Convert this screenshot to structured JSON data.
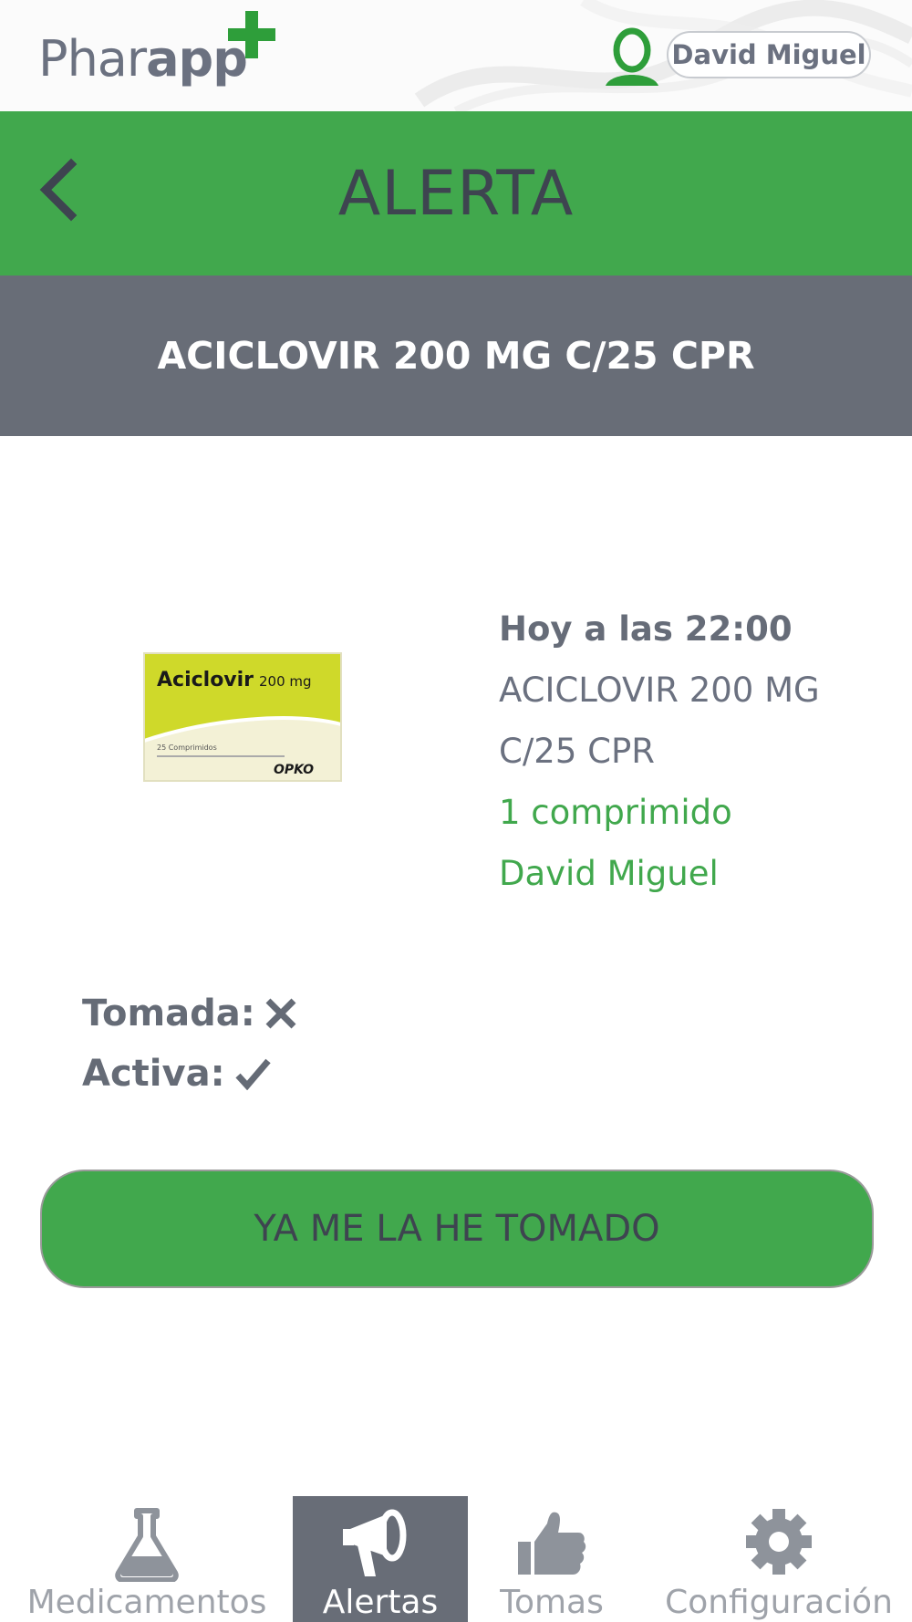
{
  "header": {
    "logo_part1": "Phar",
    "logo_part2": "app",
    "user_name": "David Miguel"
  },
  "title_bar": {
    "title": "ALERTA"
  },
  "medication_bar": {
    "name": "ACICLOVIR 200 MG C/25 CPR"
  },
  "alert": {
    "time": "Hoy a las 22:00",
    "medication_line1": "ACICLOVIR 200 MG",
    "medication_line2": "C/25 CPR",
    "dose": "1 comprimido",
    "patient": "David Miguel",
    "product_box": {
      "brand": "Aciclovir",
      "strength": "200 mg",
      "count": "25 Comprimidos",
      "maker": "OPKO"
    }
  },
  "status": {
    "taken_label": "Tomada:",
    "taken_icon": "x-icon",
    "active_label": "Activa:",
    "active_icon": "check-icon"
  },
  "action": {
    "confirm_label": "YA ME LA HE TOMADO"
  },
  "nav": {
    "items": [
      {
        "label": "Medicamentos",
        "icon": "flask-icon",
        "active": false
      },
      {
        "label": "Alertas",
        "icon": "megaphone-icon",
        "active": true
      },
      {
        "label": "Tomas",
        "icon": "thumbs-up-icon",
        "active": false
      },
      {
        "label": "Configuración",
        "icon": "gear-icon",
        "active": false
      }
    ]
  },
  "colors": {
    "primary_green": "#41a84d",
    "header_grey": "#686d77",
    "text_grey": "#666c78"
  }
}
